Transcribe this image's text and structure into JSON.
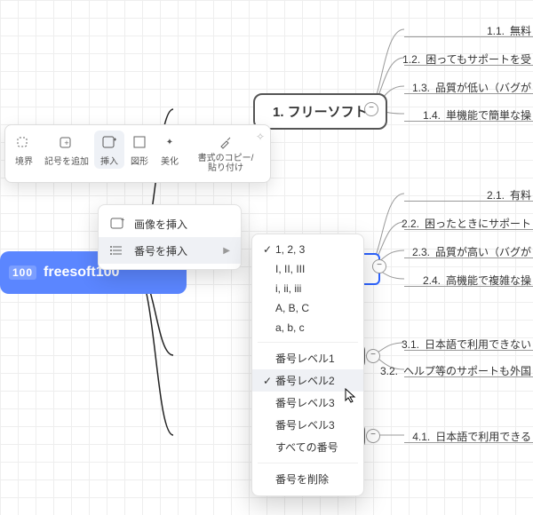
{
  "root": {
    "badge": "100",
    "label": "freesoft100"
  },
  "nodes": {
    "n1": "1.  フリーソフト"
  },
  "leaves": {
    "l11": {
      "num": "1.1.",
      "text": "無料"
    },
    "l12": {
      "num": "1.2.",
      "text": "困ってもサポートを受"
    },
    "l13": {
      "num": "1.3.",
      "text": "品質が低い（バグが"
    },
    "l14": {
      "num": "1.4.",
      "text": "単機能で簡単な操"
    },
    "l21": {
      "num": "2.1.",
      "text": "有料"
    },
    "l22": {
      "num": "2.2.",
      "text": "困ったときにサポート"
    },
    "l23": {
      "num": "2.3.",
      "text": "品質が高い（バグが"
    },
    "l24": {
      "num": "2.4.",
      "text": "高機能で複雑な操"
    },
    "l31": {
      "num": "3.1.",
      "text": "日本語で利用できない"
    },
    "l32": {
      "num": "3.2.",
      "text": "ヘルプ等のサポートも外国"
    },
    "l41": {
      "num": "4.1.",
      "text": "日本語で利用できる"
    }
  },
  "toolbar": {
    "items": {
      "boundary": "境界",
      "addmark": "記号を追加",
      "insert": "挿入",
      "shape": "図形",
      "beautify": "美化",
      "copyfmt": "書式のコピー/\n貼り付け"
    }
  },
  "menu1": {
    "image": "画像を挿入",
    "number": "番号を挿入"
  },
  "menu2": {
    "opt123": "1, 2, 3",
    "optRomanU": "I, II, III",
    "optRomanL": "i, ii, iii",
    "optABCu": "A, B, C",
    "optABCl": "a, b, c",
    "lvl1": "番号レベル1",
    "lvl2": "番号レベル2",
    "lvl3a": "番号レベル3",
    "lvl3b": "番号レベル3",
    "all": "すべての番号",
    "del": "番号を削除"
  },
  "collapse": "−"
}
